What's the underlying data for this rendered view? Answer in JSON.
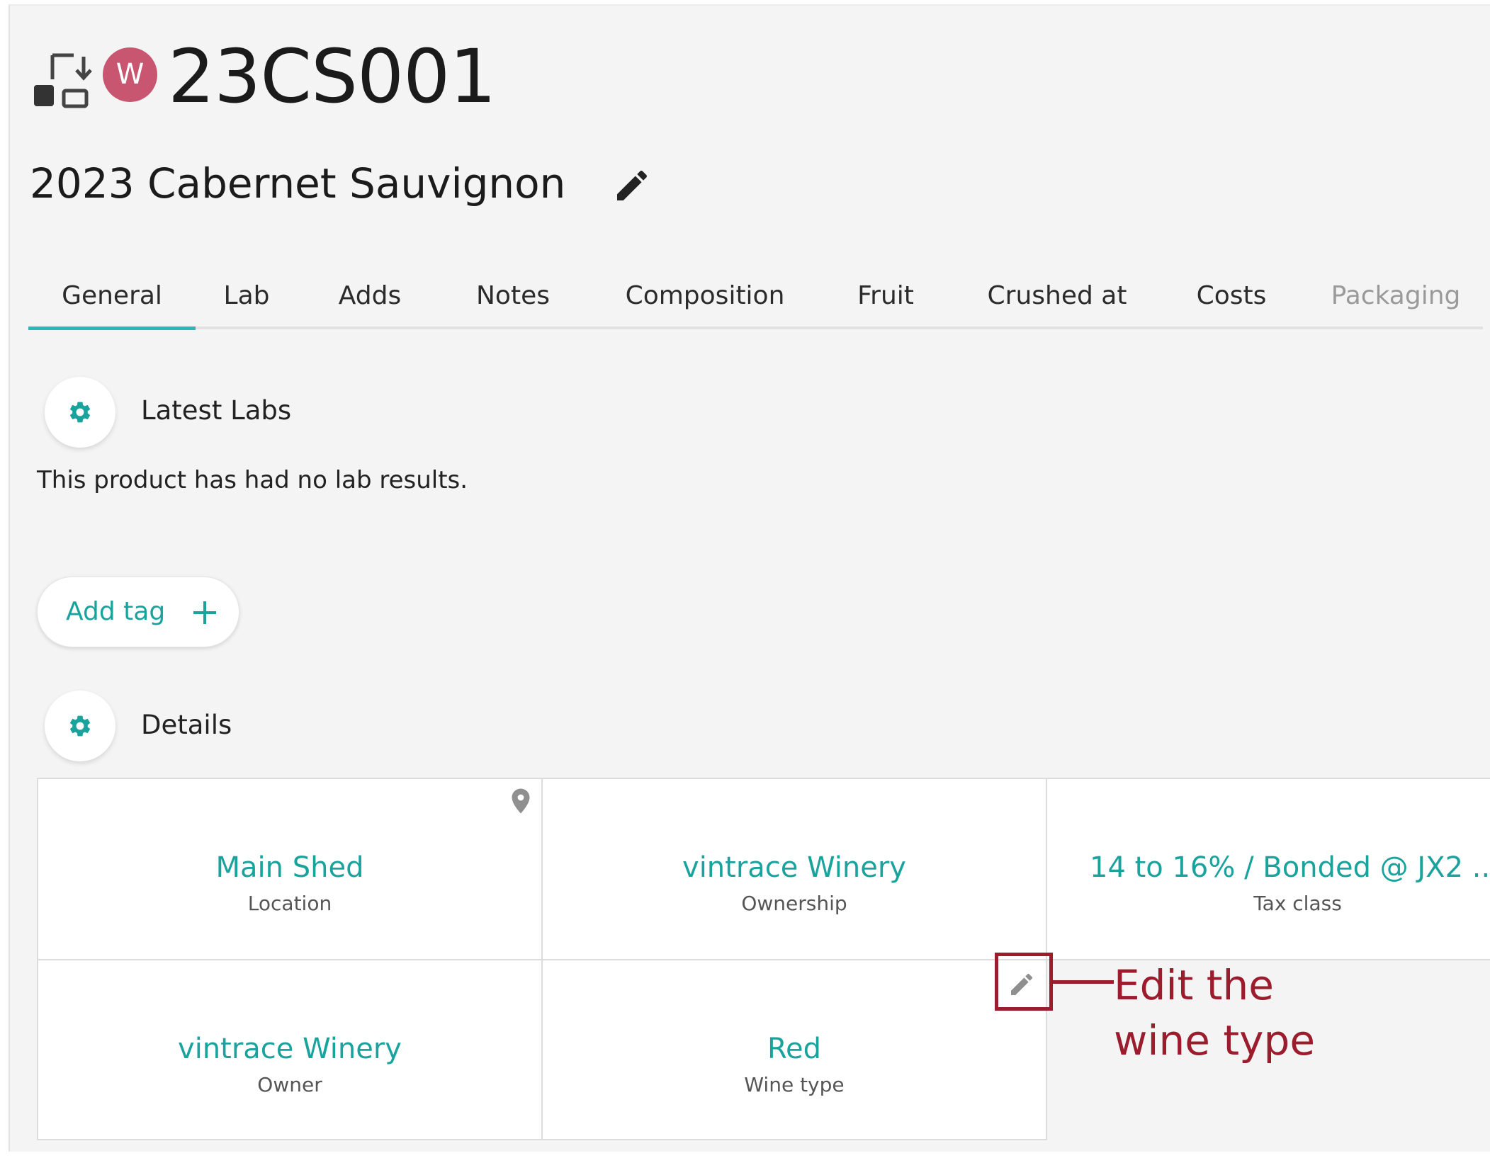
{
  "header": {
    "avatar_letter": "W",
    "avatar_color": "#c95670",
    "product_code": "23CS001",
    "product_name": "2023 Cabernet Sauvignon"
  },
  "tabs": [
    {
      "label": "General",
      "active": true
    },
    {
      "label": "Lab"
    },
    {
      "label": "Adds"
    },
    {
      "label": "Notes"
    },
    {
      "label": "Composition"
    },
    {
      "label": "Fruit"
    },
    {
      "label": "Crushed at"
    },
    {
      "label": "Costs"
    },
    {
      "label": "Packaging",
      "dimmed": true
    }
  ],
  "latest_labs": {
    "title": "Latest Labs",
    "empty_message": "This product has had no lab results."
  },
  "add_tag": {
    "label": "Add tag"
  },
  "details": {
    "title": "Details",
    "cells": [
      {
        "value": "Main Shed",
        "label": "Location"
      },
      {
        "value": "vintrace Winery",
        "label": "Ownership"
      },
      {
        "value": "14 to 16% / Bonded @ JX2 ...",
        "label": "Tax class"
      },
      {
        "value": "vintrace Winery",
        "label": "Owner"
      },
      {
        "value": "Red",
        "label": "Wine type"
      }
    ]
  },
  "annotation": {
    "line1": "Edit the",
    "line2": "wine type"
  },
  "colors": {
    "accent_teal": "#1aa39d",
    "tab_underline": "#2bb8b2",
    "annotation_red": "#9b1c2c"
  }
}
